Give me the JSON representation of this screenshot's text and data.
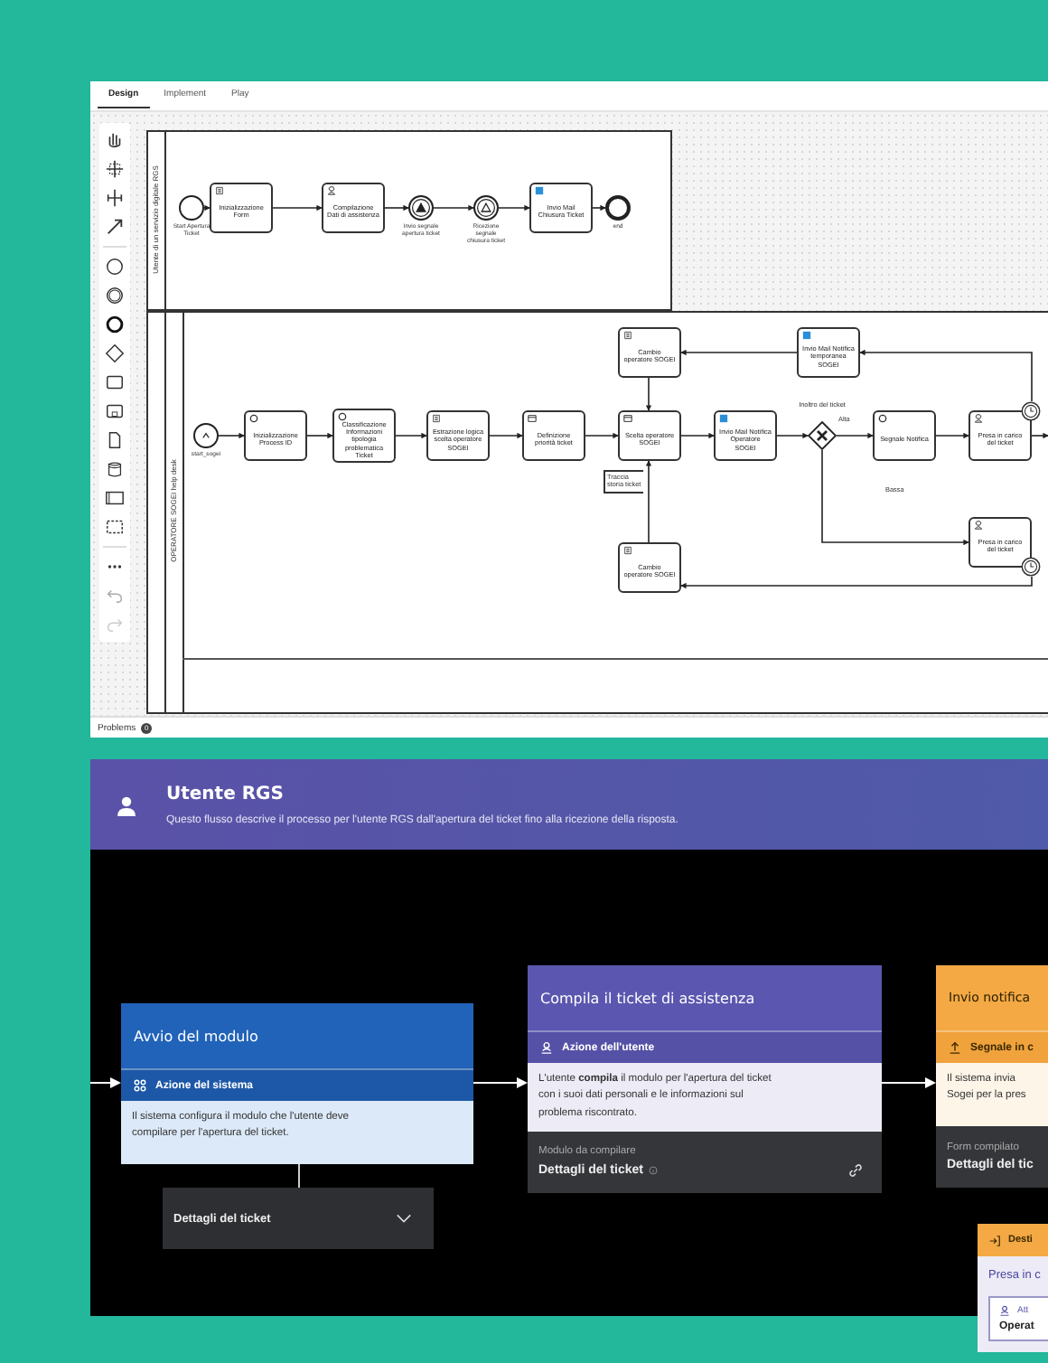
{
  "editor": {
    "tabs": [
      {
        "label": "Design",
        "selected": true
      },
      {
        "label": "Implement",
        "selected": false
      },
      {
        "label": "Play",
        "selected": false
      }
    ],
    "pools": [
      {
        "label": "Utente di un servizio digitale RGS",
        "elements": [
          {
            "kind": "start",
            "text": "Start Apertura Ticket"
          },
          {
            "kind": "script-task",
            "text": "Inizializzazione Form"
          },
          {
            "kind": "user-task",
            "text": "Compilazione Dati di assistenza"
          },
          {
            "kind": "throw-event",
            "text": "Invio segnale apertura ticket"
          },
          {
            "kind": "catch-event",
            "text": "Ricezione segnale chiusura ticket"
          },
          {
            "kind": "send-task",
            "text": "Invio Mail Chiusura Ticket"
          },
          {
            "kind": "end",
            "text": "end"
          }
        ]
      },
      {
        "label": "OPERATORE SOGEI help desk",
        "elements": [
          {
            "kind": "start",
            "text": "start_sogei"
          },
          {
            "kind": "service-task",
            "text": "Inizializzazione Process ID"
          },
          {
            "kind": "service-task",
            "text": "Classificazione Informazioni tipologia problematica Ticket"
          },
          {
            "kind": "script-task",
            "text": "Estrazione logica scelta operatore SOGEI"
          },
          {
            "kind": "rule-task",
            "text": "Definizione priorità ticket"
          },
          {
            "kind": "rule-task",
            "text": "Scelta operatore SOGEI"
          },
          {
            "kind": "send-task",
            "text": "Invio Mail Notifica Operatore SOGEI"
          },
          {
            "kind": "gateway",
            "text": "Inoltro del ticket"
          },
          {
            "kind": "label",
            "text": "Alta"
          },
          {
            "kind": "service-task",
            "text": "Segnale Notifica"
          },
          {
            "kind": "timer-task",
            "text": "Presa in carico del ticket"
          },
          {
            "kind": "label",
            "text": "Bassa"
          },
          {
            "kind": "timer-task",
            "text": "Presa in carico del ticket"
          },
          {
            "kind": "script-task",
            "text": "Cambio operatore SOGEI"
          },
          {
            "kind": "send-task",
            "text": "Invio Mail Notifica temporanea SOGEI"
          },
          {
            "kind": "annotation",
            "text": "Traccia storia ticket"
          },
          {
            "kind": "script-task",
            "text": "Cambio operatore SOGEI"
          }
        ]
      }
    ],
    "problems": {
      "label": "Problems",
      "count": "0"
    }
  },
  "flow": {
    "header": {
      "title": "Utente RGS",
      "description": "Questo flusso descrive il processo per l'utente RGS dall'apertura del ticket fino alla ricezione della risposta."
    },
    "cards": [
      {
        "kind": "system",
        "title": "Avvio del modulo",
        "action": "Azione del sistema",
        "body": [
          "Il sistema configura il modulo che l'utente deve",
          "compilare per l'apertura del ticket."
        ],
        "output": {
          "title": "Dettagli del ticket",
          "expanded": false
        }
      },
      {
        "kind": "user",
        "title": "Compila il ticket di assistenza",
        "action": "Azione dell'utente",
        "body": [
          "L'utente **compila** il modulo per l'apertura del ticket",
          "con i suoi dati personali e le informazioni sul",
          "problema riscontrato."
        ],
        "footer_label": "Modulo da compilare",
        "footer_value": "Dettagli del ticket"
      },
      {
        "kind": "signal",
        "title": "Invio notifica",
        "action": "Segnale in c",
        "body": [
          "Il sistema invia",
          "Sogei per la pres"
        ],
        "footer_label": "Form compilato",
        "footer_value": "Dettagli del tic"
      }
    ],
    "destination": {
      "header": "Desti",
      "title": "Presa in c",
      "actor_label": "Att",
      "actor_value": "Operat"
    }
  }
}
